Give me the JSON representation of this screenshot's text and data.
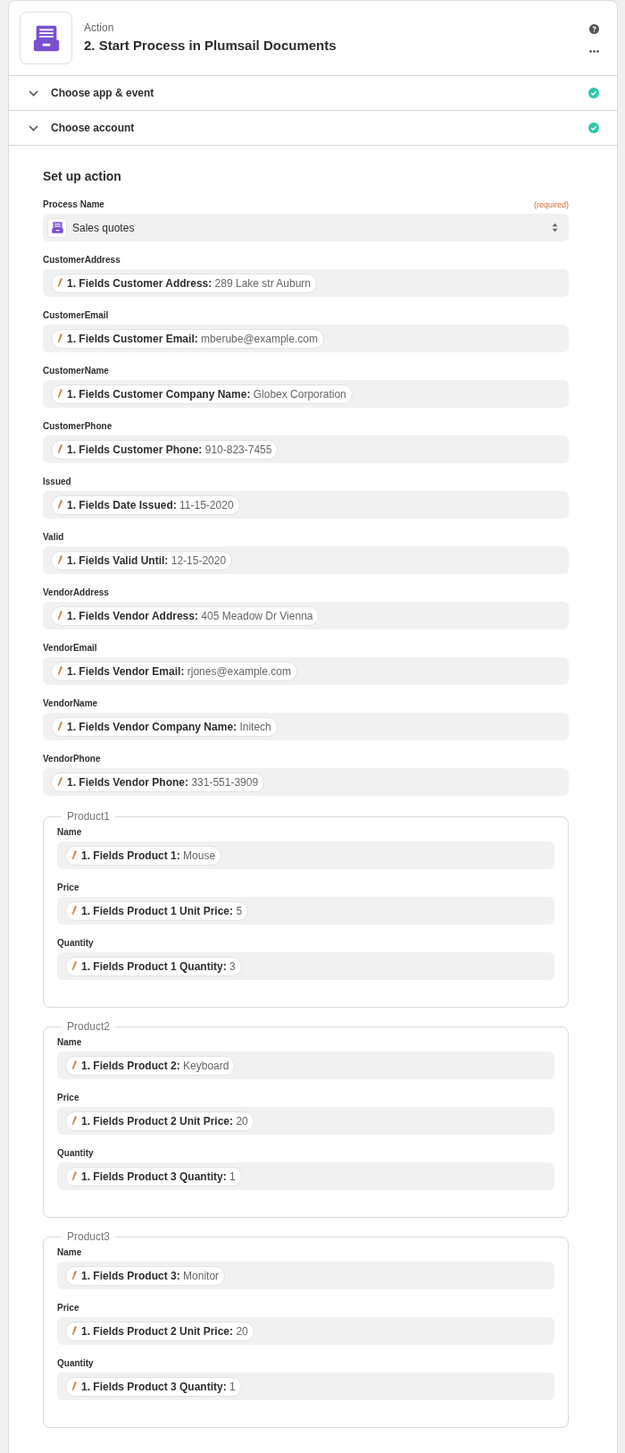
{
  "header": {
    "kind_label": "Action",
    "title": "2. Start Process in Plumsail Documents"
  },
  "sections": [
    {
      "label": "Choose app & event",
      "complete": true
    },
    {
      "label": "Choose account",
      "complete": true
    }
  ],
  "setup": {
    "title": "Set up action",
    "process": {
      "label": "Process Name",
      "required": "(required)",
      "value": "Sales quotes"
    },
    "fields": [
      {
        "label": "CustomerAddress",
        "token_label": "1. Fields Customer Address:",
        "token_value": "289 Lake str Auburn"
      },
      {
        "label": "CustomerEmail",
        "token_label": "1. Fields Customer Email:",
        "token_value": "mberube@example.com"
      },
      {
        "label": "CustomerName",
        "token_label": "1. Fields Customer Company Name:",
        "token_value": "Globex Corporation"
      },
      {
        "label": "CustomerPhone",
        "token_label": "1. Fields Customer Phone:",
        "token_value": "910-823-7455"
      },
      {
        "label": "Issued",
        "token_label": "1. Fields Date Issued:",
        "token_value": "11-15-2020"
      },
      {
        "label": "Valid",
        "token_label": "1. Fields Valid Until:",
        "token_value": "12-15-2020"
      },
      {
        "label": "VendorAddress",
        "token_label": "1. Fields Vendor Address:",
        "token_value": "405 Meadow Dr Vienna"
      },
      {
        "label": "VendorEmail",
        "token_label": "1. Fields Vendor Email:",
        "token_value": "rjones@example.com"
      },
      {
        "label": "VendorName",
        "token_label": "1. Fields Vendor Company Name:",
        "token_value": "Initech"
      },
      {
        "label": "VendorPhone",
        "token_label": "1. Fields Vendor Phone:",
        "token_value": "331-551-3909"
      }
    ],
    "groups": [
      {
        "legend": "Product1",
        "fields": [
          {
            "label": "Name",
            "token_label": "1. Fields Product 1:",
            "token_value": "Mouse"
          },
          {
            "label": "Price",
            "token_label": "1. Fields Product 1 Unit Price:",
            "token_value": "5"
          },
          {
            "label": "Quantity",
            "token_label": "1. Fields Product 1 Quantity:",
            "token_value": "3"
          }
        ]
      },
      {
        "legend": "Product2",
        "fields": [
          {
            "label": "Name",
            "token_label": "1. Fields Product 2:",
            "token_value": "Keyboard"
          },
          {
            "label": "Price",
            "token_label": "1. Fields Product 2 Unit Price:",
            "token_value": "20"
          },
          {
            "label": "Quantity",
            "token_label": "1. Fields Product 3 Quantity:",
            "token_value": "1"
          }
        ]
      },
      {
        "legend": "Product3",
        "fields": [
          {
            "label": "Name",
            "token_label": "1. Fields Product 3:",
            "token_value": "Monitor"
          },
          {
            "label": "Price",
            "token_label": "1. Fields Product 2 Unit Price:",
            "token_value": "20"
          },
          {
            "label": "Quantity",
            "token_label": "1. Fields Product 3 Quantity:",
            "token_value": "1"
          }
        ]
      }
    ]
  }
}
